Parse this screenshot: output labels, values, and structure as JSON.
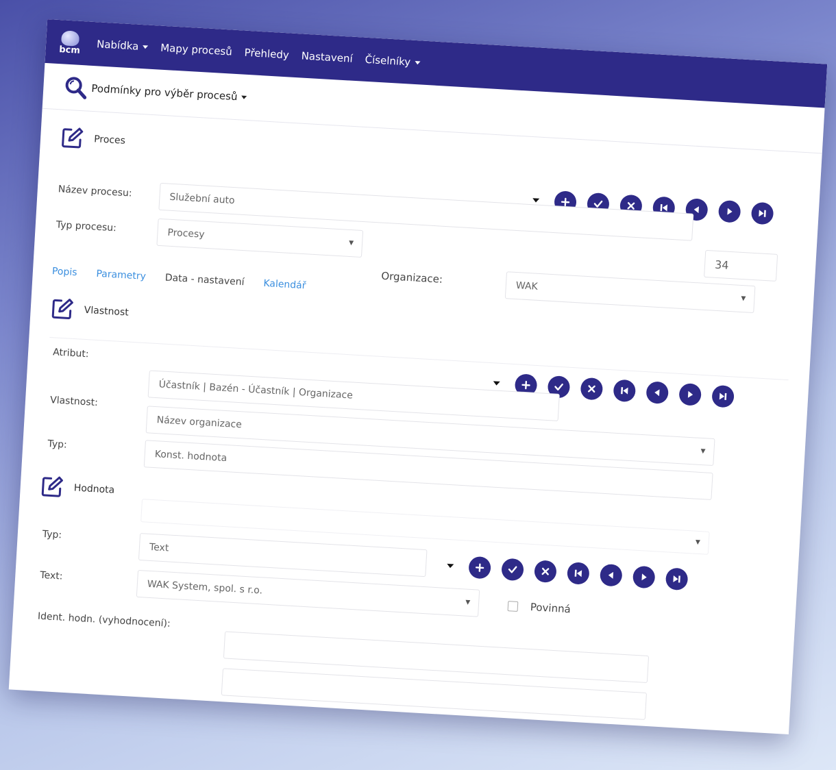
{
  "nav": {
    "logo_text": "bcm",
    "items": [
      {
        "label": "Nabídka",
        "dropdown": true
      },
      {
        "label": "Mapy procesů",
        "dropdown": false
      },
      {
        "label": "Přehledy",
        "dropdown": false
      },
      {
        "label": "Nastavení",
        "dropdown": false
      },
      {
        "label": "Číselníky",
        "dropdown": true
      }
    ]
  },
  "filter": {
    "label": "Podmínky pro výběr procesů"
  },
  "proces": {
    "title": "Proces",
    "name_label": "Název procesu:",
    "name_value": "Služební auto",
    "type_label": "Typ procesu:",
    "type_value": "Procesy",
    "id_value": "34",
    "org_label": "Organizace:",
    "org_value": "WAK"
  },
  "tabs": [
    {
      "label": "Popis",
      "active": false
    },
    {
      "label": "Parametry",
      "active": false
    },
    {
      "label": "Data - nastavení",
      "active": true
    },
    {
      "label": "Kalendář",
      "active": false
    }
  ],
  "vlastnost": {
    "title": "Vlastnost",
    "attr_label": "Atribut:",
    "attr_value": "Účastník | Bazén - Účastník | Organizace",
    "prop_label": "Vlastnost:",
    "prop_value": "Název organizace",
    "type_label": "Typ:",
    "type_value": "Konst. hodnota"
  },
  "hodnota": {
    "title": "Hodnota",
    "type_label": "Typ:",
    "type_value": "Text",
    "text_label": "Text:",
    "text_value": "WAK System, spol. s r.o.",
    "required_label": "Povinná",
    "ident_label": "Ident. hodn. (vyhodnocení):",
    "ident_value": ""
  },
  "toolbar_buttons": [
    "add",
    "confirm",
    "cancel",
    "first",
    "previous",
    "next",
    "last"
  ],
  "colors": {
    "primary": "#2e2a88",
    "link": "#3b8fdf"
  }
}
